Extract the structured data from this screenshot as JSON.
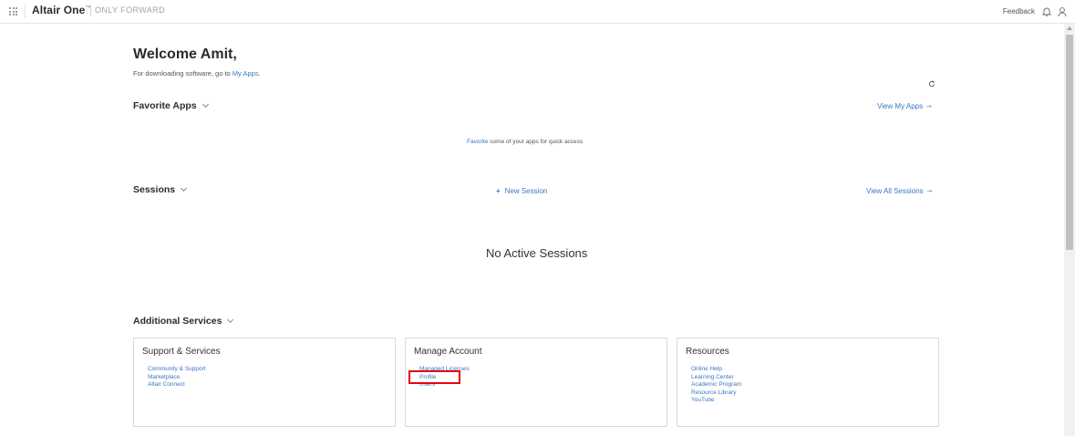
{
  "header": {
    "brand": "Altair One",
    "brand_mark": "™",
    "tagline": "ONLY FORWARD",
    "feedback_label": "Feedback",
    "icons": [
      "apps-grid-icon",
      "bell-icon",
      "user-icon"
    ]
  },
  "welcome": {
    "title": "Welcome Amit,",
    "subtext_prefix": "For downloading software, go to ",
    "subtext_link": "My Apps",
    "subtext_suffix": "."
  },
  "favorite_apps": {
    "title": "Favorite Apps",
    "view_link": "View My Apps",
    "empty_link": "Favorite",
    "empty_text": " some of your apps for quick access"
  },
  "sessions": {
    "title": "Sessions",
    "new_session_label": "New Session",
    "view_link": "View All Sessions",
    "empty_text": "No Active Sessions"
  },
  "additional_services": {
    "title": "Additional Services",
    "cards": [
      {
        "title": "Support & Services",
        "links": [
          "Community & Support",
          "Marketplace",
          "Altair Connect"
        ]
      },
      {
        "title": "Manage Account",
        "links": [
          "Managed Licenses",
          "Profile",
          "Users"
        ]
      },
      {
        "title": "Resources",
        "links": [
          "Online Help",
          "Learning Center",
          "Academic Program",
          "Resource Library",
          "YouTube"
        ]
      }
    ]
  },
  "colors": {
    "link": "#3a77c7",
    "highlight": "#e30613",
    "text": "#2b2b2b"
  }
}
